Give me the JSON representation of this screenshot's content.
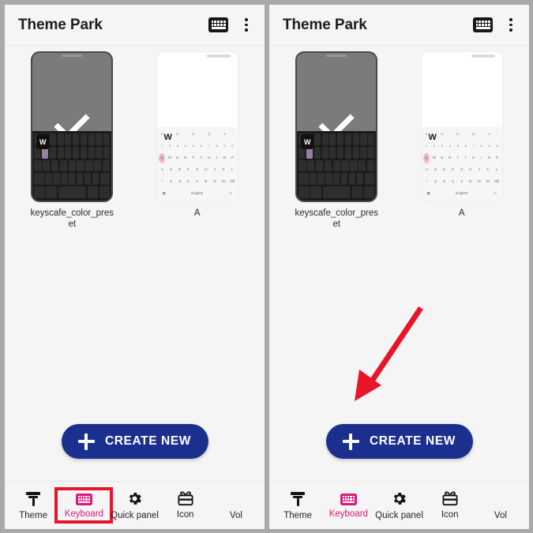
{
  "header": {
    "title": "Theme Park",
    "keyboard_icon": "keyboard-icon",
    "overflow_icon": "more-vertical-icon"
  },
  "thumbnails": [
    {
      "label": "keyscafe_color_preset",
      "selected": true,
      "style": "dark",
      "popup_key": "W",
      "check_icon": "check-icon"
    },
    {
      "label": "A",
      "selected": false,
      "style": "light",
      "popup_key": "W"
    }
  ],
  "keyboard_preview": {
    "row_number": [
      "1",
      "2",
      "3",
      "4",
      "5",
      "6",
      "7",
      "8",
      "9",
      "0"
    ],
    "row_symbols": [
      "C",
      "O",
      "D",
      "Q",
      "B",
      "4",
      "~"
    ],
    "row1": [
      "Q",
      "W",
      "E",
      "R",
      "T",
      "Y",
      "U",
      "I",
      "O",
      "P"
    ],
    "row2": [
      "A",
      "S",
      "D",
      "F",
      "G",
      "H",
      "J",
      "K",
      "L"
    ],
    "row3": [
      "Z",
      "X",
      "C",
      "V",
      "B",
      "N",
      "M"
    ],
    "shift_key": "shift",
    "backspace_key": "backspace",
    "space_key": "English",
    "symbol_key": "!#1",
    "enter_key": "enter"
  },
  "create_button": {
    "label": "CREATE NEW",
    "plus_icon": "plus-icon",
    "color": "#1b2f8f"
  },
  "bottom_nav": {
    "items": [
      {
        "label": "Theme",
        "icon": "paint-roller-icon",
        "active": false
      },
      {
        "label": "Keyboard",
        "icon": "keyboard-icon",
        "active": true
      },
      {
        "label": "Quick panel",
        "icon": "gear-icon",
        "active": false
      },
      {
        "label": "Icon",
        "icon": "gift-icon",
        "active": false
      },
      {
        "label": "Vol",
        "icon": "volume-icon",
        "active": false
      }
    ],
    "active_color": "#d81b7a"
  },
  "annotations": {
    "highlight_box_color": "#e8152a",
    "highlight_target": "Keyboard",
    "arrow_color": "#e8152a",
    "arrow_target": "CREATE NEW"
  }
}
